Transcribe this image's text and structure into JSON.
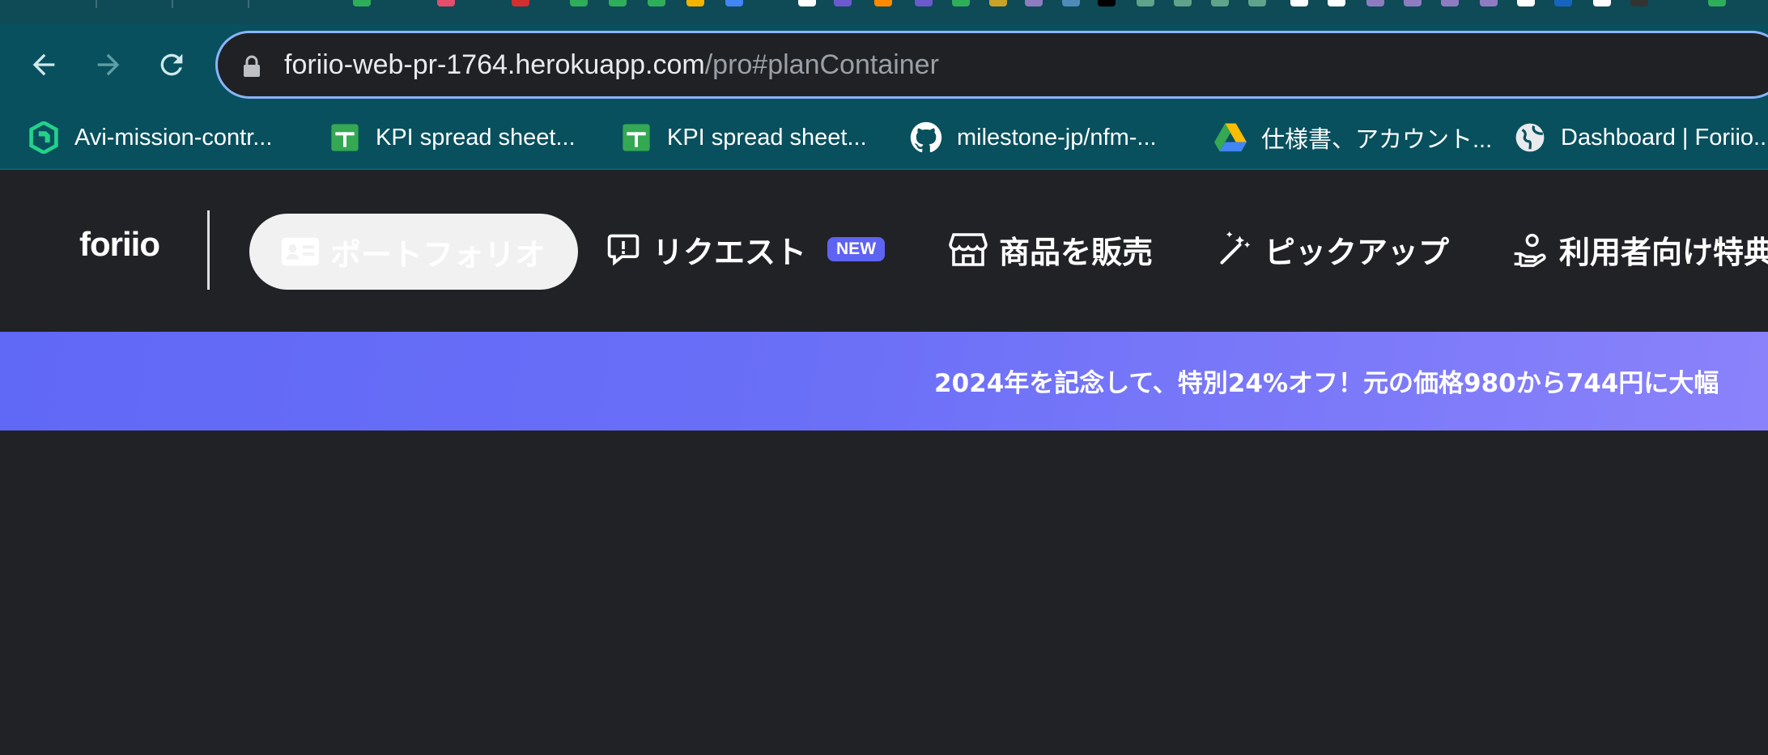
{
  "browser": {
    "address_bar": {
      "host": "foriio-web-pr-1764.herokuapp.com",
      "path": "/pro#planContainer"
    },
    "bookmarks": [
      {
        "label": "Avi-mission-contr...",
        "icon": "avi-logo-icon"
      },
      {
        "label": "KPI spread sheet...",
        "icon": "google-sheets-icon"
      },
      {
        "label": "KPI spread sheet...",
        "icon": "google-sheets-icon"
      },
      {
        "label": "milestone-jp/nfm-...",
        "icon": "github-icon"
      },
      {
        "label": "仕様書、アカウント...",
        "icon": "google-drive-icon"
      },
      {
        "label": "Dashboard | Foriio...",
        "icon": "globe-icon"
      }
    ]
  },
  "site": {
    "logo": "foriio",
    "nav": {
      "portfolio": "ポートフォリオ",
      "request": "リクエスト",
      "request_badge": "NEW",
      "sell": "商品を販売",
      "pickup": "ピックアップ",
      "benefits": "利用者向け特典"
    },
    "banner": "2024年を記念して、特別24%オフ！元の価格980から744円に大幅"
  },
  "colors": {
    "banner_start": "#6068f6",
    "banner_end": "#8a82fb",
    "badge": "#5f63f2",
    "toolbar": "#08505e",
    "page_bg": "#212226"
  }
}
